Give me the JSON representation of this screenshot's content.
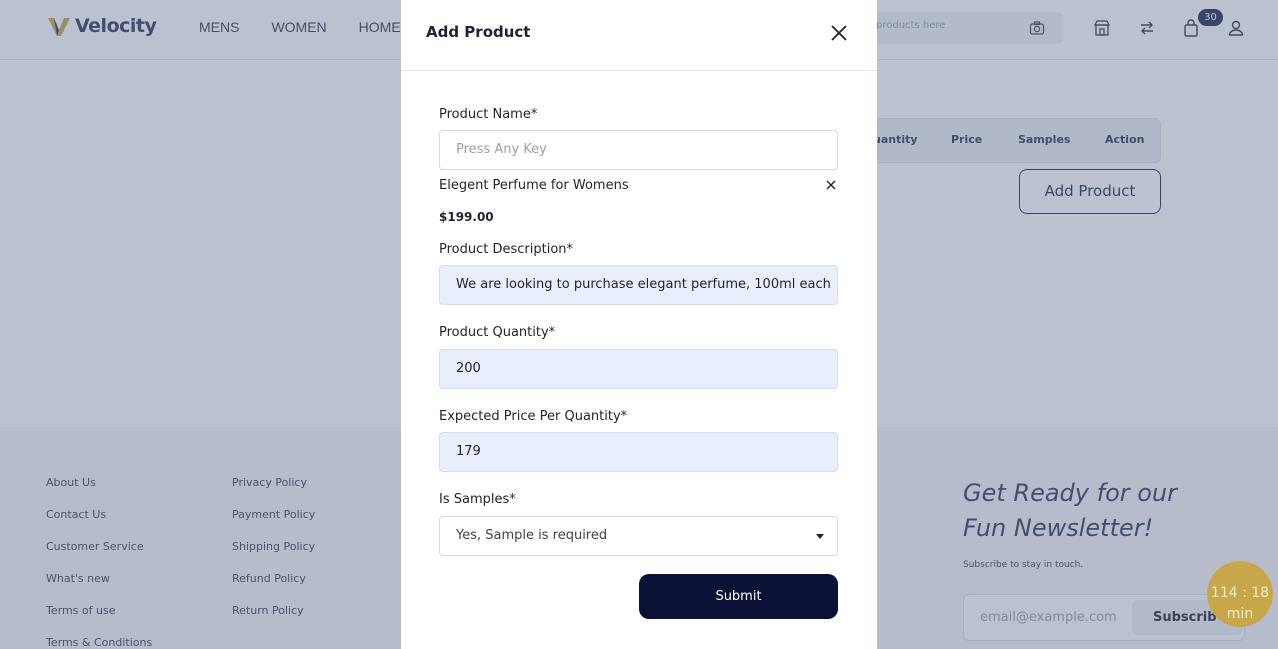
{
  "header": {
    "brand": "Velocity",
    "nav": [
      "MENS",
      "WOMEN",
      "HOME"
    ],
    "search_placeholder": "products here",
    "cart_count": "30",
    "icons": [
      "camera-icon",
      "store-icon",
      "compare-icon",
      "cart-icon",
      "user-icon"
    ]
  },
  "table": {
    "columns": [
      "uantity",
      "Price",
      "Samples",
      "Action"
    ],
    "add_button": "Add Product"
  },
  "footer": {
    "col1": [
      "About Us",
      "Contact Us",
      "Customer Service",
      "What's new",
      "Terms of use",
      "Terms & Conditions"
    ],
    "col2": [
      "Privacy Policy",
      "Payment Policy",
      "Shipping Policy",
      "Refund Policy",
      "Return Policy"
    ],
    "newsletter": {
      "title_line1": "Get Ready for our",
      "title_line2": "Fun Newsletter!",
      "subtitle": "Subscribe to stay in touch.",
      "email_placeholder": "email@example.com",
      "button": "Subscrib"
    }
  },
  "timer": {
    "time": "114 : 18",
    "unit": "min"
  },
  "modal": {
    "title": "Add Product",
    "product_name_label": "Product Name*",
    "product_name_placeholder": "Press Any Key",
    "selected_product": "Elegent Perfume for Womens",
    "selected_price": "$199.00",
    "description_label": "Product Description*",
    "description_value": "We are looking to purchase elegant perfume, 100ml each",
    "quantity_label": "Product Quantity*",
    "quantity_value": "200",
    "price_label": "Expected Price Per Quantity*",
    "price_value": "179",
    "samples_label": "Is Samples*",
    "samples_value": "Yes, Sample is required",
    "submit": "Submit"
  },
  "colors": {
    "brand_navy": "#0b1136",
    "logo_gold": "#c7a74a",
    "input_fill": "#e8eefc"
  }
}
